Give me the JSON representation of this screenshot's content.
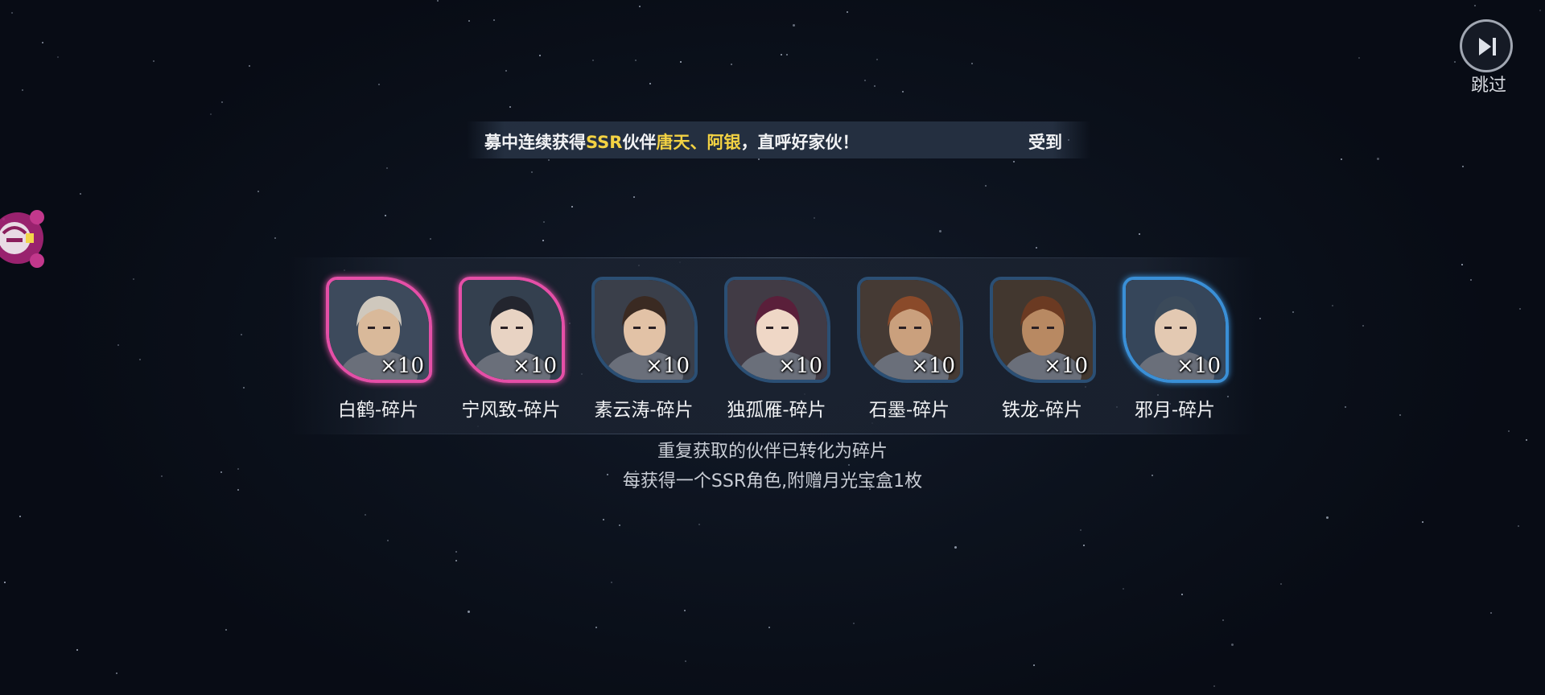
{
  "skip": {
    "label": "跳过",
    "icon": "skip-forward-icon"
  },
  "banner": {
    "prefix": "募中连续获得",
    "ssr": "SSR",
    "mid": "伙伴",
    "name1": "唐天",
    "sep": "、",
    "name2": "阿银",
    "suffix": "，直呼好家伙！",
    "next_fragment": "受到"
  },
  "mascot": {
    "icon": "mascot-icon"
  },
  "rewards": [
    {
      "name": "白鹤-碎片",
      "quantity": "×10",
      "frame_color": "#e54fa7",
      "rarity": "pink"
    },
    {
      "name": "宁风致-碎片",
      "quantity": "×10",
      "frame_color": "#e54fa7",
      "rarity": "pink"
    },
    {
      "name": "素云涛-碎片",
      "quantity": "×10",
      "frame_color": "#2b4f74",
      "rarity": "dark"
    },
    {
      "name": "独孤雁-碎片",
      "quantity": "×10",
      "frame_color": "#2b4f74",
      "rarity": "dark"
    },
    {
      "name": "石墨-碎片",
      "quantity": "×10",
      "frame_color": "#2b4f74",
      "rarity": "dark"
    },
    {
      "name": "铁龙-碎片",
      "quantity": "×10",
      "frame_color": "#2b4f74",
      "rarity": "dark"
    },
    {
      "name": "邪月-碎片",
      "quantity": "×10",
      "frame_color": "#3a8fd6",
      "rarity": "blue"
    }
  ],
  "info": {
    "line1": "重复获取的伙伴已转化为碎片",
    "line2": "每获得一个SSR角色,附赠月光宝盒1枚"
  },
  "colors": {
    "highlight": "#f3d243",
    "pink_frame": "#e54fa7",
    "blue_frame": "#3a8fd6",
    "dark_frame": "#2b4f74"
  }
}
